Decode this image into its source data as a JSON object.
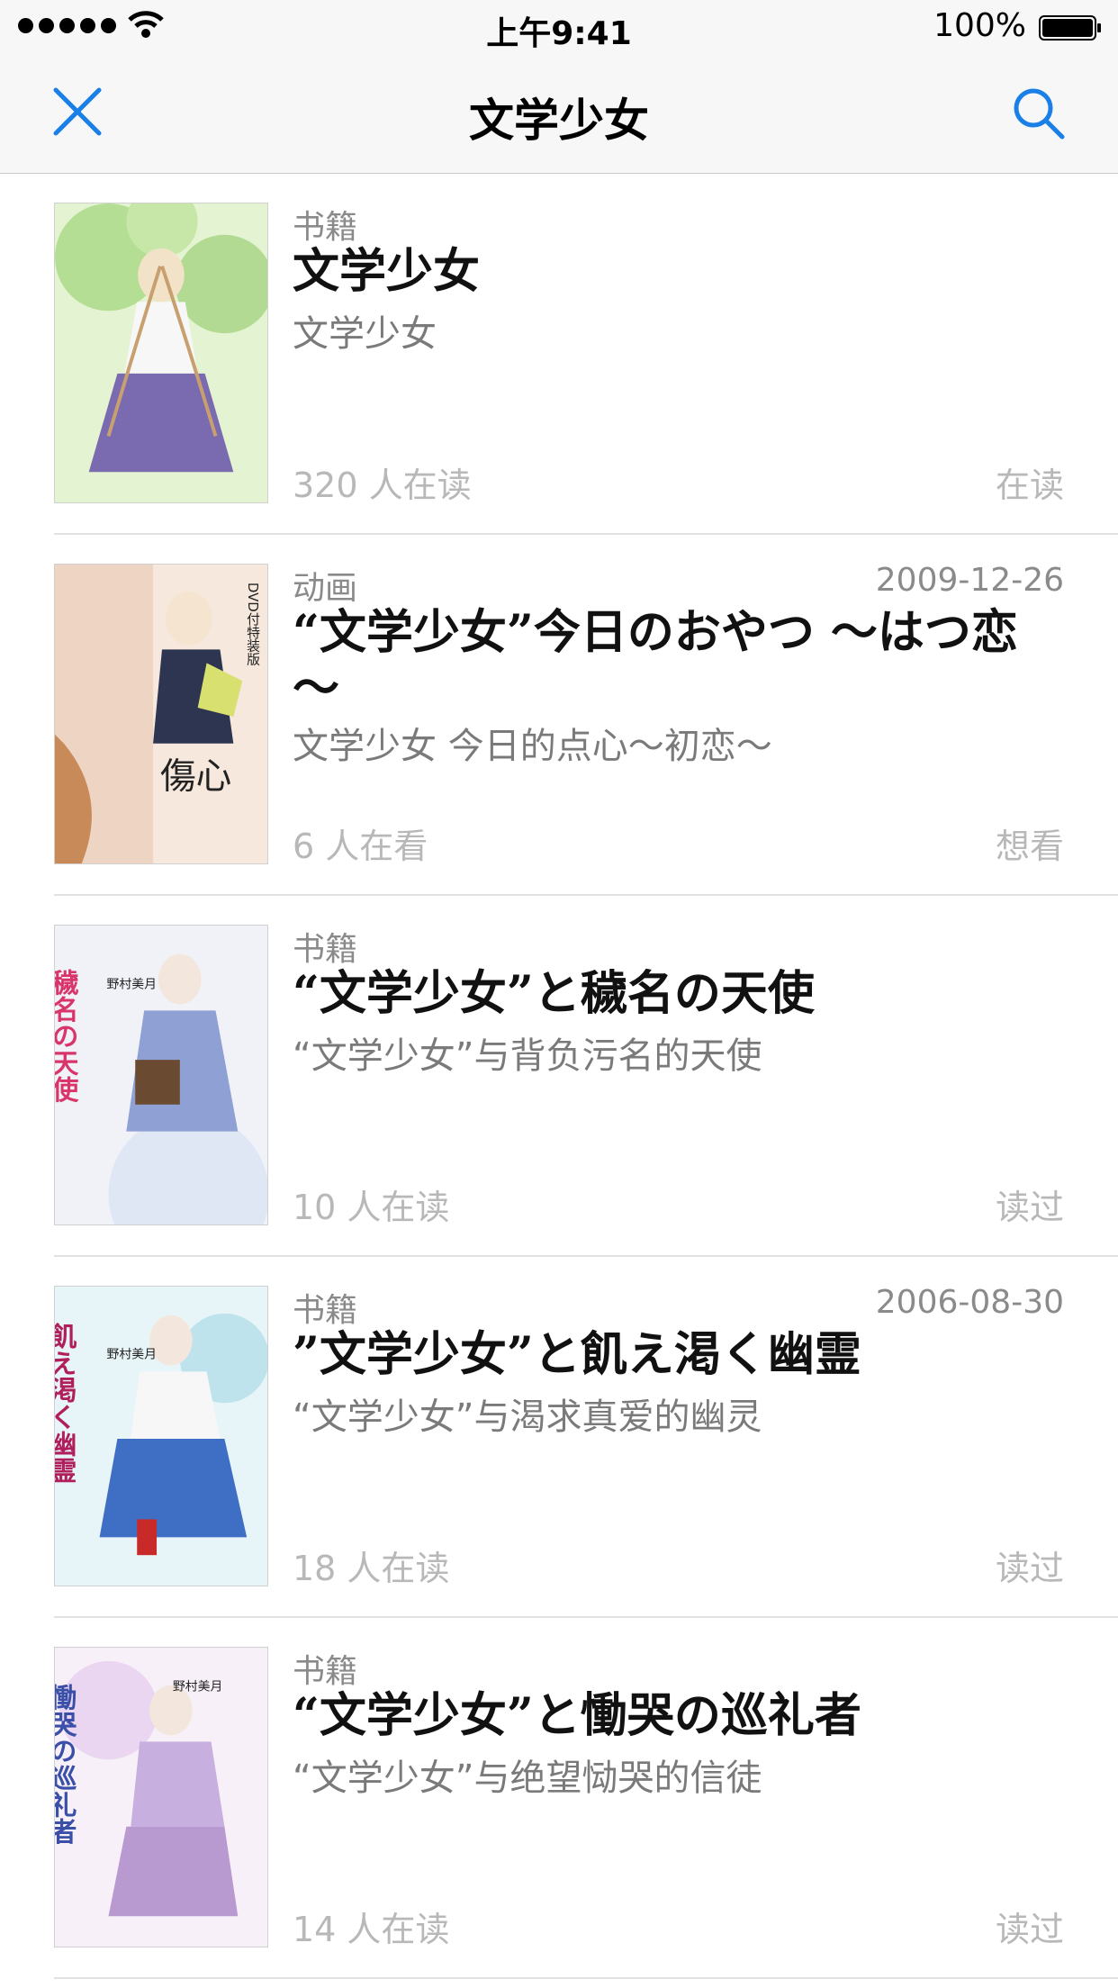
{
  "status_bar": {
    "time": "上午9:41",
    "battery": "100%"
  },
  "nav": {
    "title": "文学少女",
    "close_icon": "close-icon",
    "search_icon": "search-icon"
  },
  "results": [
    {
      "category": "书籍",
      "date": "",
      "title": "文学少女",
      "subtitle": "文学少女",
      "count": "320 人在读",
      "status": "在读",
      "cover_colors": [
        "#dff2c8",
        "#8fc86a",
        "#6b5aa0"
      ]
    },
    {
      "category": "动画",
      "date": "2009-12-26",
      "title": "“文学少女”今日のおやつ ～はつ恋～",
      "subtitle": "文学少女 今日的点心～初恋～",
      "count": "6 人在看",
      "status": "想看",
      "cover_colors": [
        "#f3e3d6",
        "#c98a5a",
        "#7a3b2a"
      ],
      "cover_text": [
        "DVD付特装版",
        "傷心"
      ]
    },
    {
      "category": "书籍",
      "date": "",
      "title": "“文学少女”と穢名の天使",
      "subtitle": "“文学少女”与背负污名的天使",
      "count": "10 人在读",
      "status": "读过",
      "cover_colors": [
        "#eef0f6",
        "#a9b4d8",
        "#d9356a"
      ],
      "cover_text": [
        "穢名の天使",
        "野村美月"
      ]
    },
    {
      "category": "书籍",
      "date": "2006-08-30",
      "title": "”文学少女”と飢え渇く幽霊",
      "subtitle": "“文学少女”与渴求真爱的幽灵",
      "count": "18 人在读",
      "status": "读过",
      "cover_colors": [
        "#e6f4f8",
        "#3f6fc4",
        "#b01f5c"
      ],
      "cover_text": [
        "飢え渇く幽霊",
        "野村美月"
      ]
    },
    {
      "category": "书籍",
      "date": "",
      "title": "“文学少女”と慟哭の巡礼者",
      "subtitle": "“文学少女”与绝望恸哭的信徒",
      "count": "14 人在读",
      "status": "读过",
      "cover_colors": [
        "#f5eef6",
        "#b89ad0",
        "#3a4fa8"
      ],
      "cover_text": [
        "慟哭の巡礼者",
        "野村美月"
      ]
    }
  ]
}
